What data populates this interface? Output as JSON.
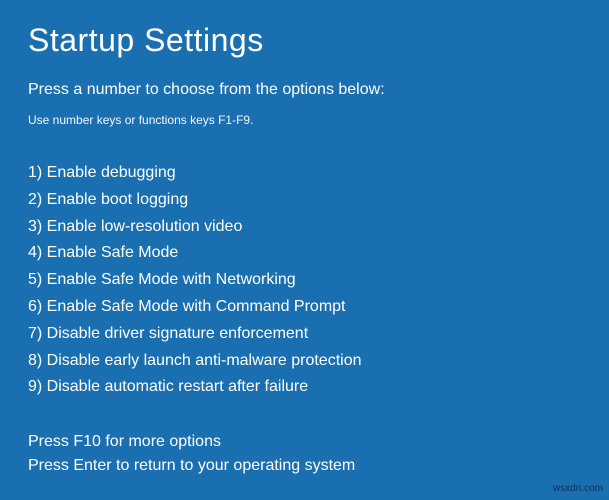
{
  "title": "Startup Settings",
  "subtitle": "Press a number to choose from the options below:",
  "hint": "Use number keys or functions keys F1-F9.",
  "options": [
    "1) Enable debugging",
    "2) Enable boot logging",
    "3) Enable low-resolution video",
    "4) Enable Safe Mode",
    "5) Enable Safe Mode with Networking",
    "6) Enable Safe Mode with Command Prompt",
    "7) Disable driver signature enforcement",
    "8) Disable early launch anti-malware protection",
    "9) Disable automatic restart after failure"
  ],
  "footer": {
    "more_options": "Press F10 for more options",
    "return_line": "Press Enter to return to your operating system"
  },
  "watermark": "wsxdn.com"
}
